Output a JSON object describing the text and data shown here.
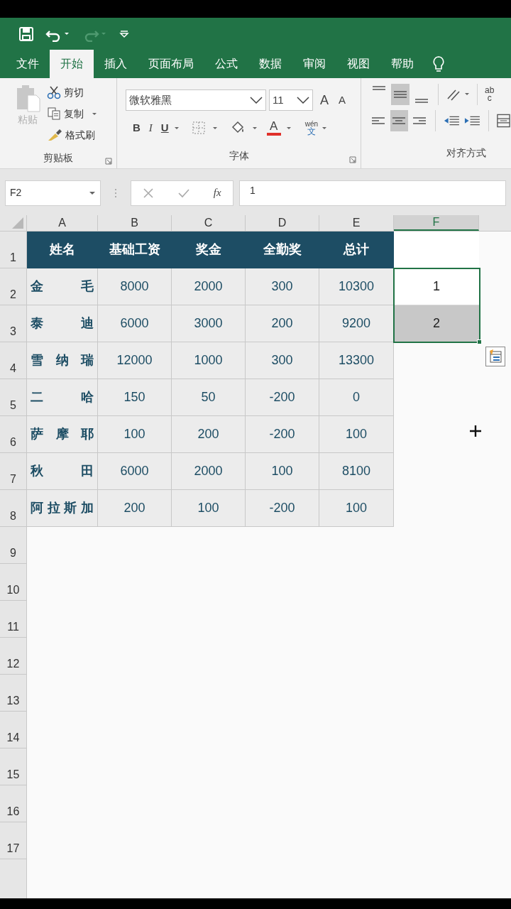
{
  "tabs": [
    {
      "label": "文件",
      "selected": false
    },
    {
      "label": "开始",
      "selected": true
    },
    {
      "label": "插入",
      "selected": false
    },
    {
      "label": "页面布局",
      "selected": false
    },
    {
      "label": "公式",
      "selected": false
    },
    {
      "label": "数据",
      "selected": false
    },
    {
      "label": "审阅",
      "selected": false
    },
    {
      "label": "视图",
      "selected": false
    },
    {
      "label": "帮助",
      "selected": false
    }
  ],
  "clipboard": {
    "paste": {
      "label": "粘贴",
      "disabled": true
    },
    "cut": "剪切",
    "copy": "复制",
    "format_painter": "格式刷",
    "group_label": "剪贴板"
  },
  "font": {
    "name": "微软雅黑",
    "size": "11",
    "grow": "A",
    "shrink": "A",
    "bold": "B",
    "italic": "I",
    "underline": "U",
    "font_color": "A",
    "phonetic_top": "wén",
    "phonetic_bottom": "文",
    "group_label": "字体"
  },
  "alignment": {
    "vertical": [
      {
        "kind": "top",
        "selected": false
      },
      {
        "kind": "middle",
        "selected": true
      },
      {
        "kind": "bottom",
        "selected": false
      }
    ],
    "horizontal": [
      {
        "kind": "left",
        "selected": false
      },
      {
        "kind": "center",
        "selected": true
      },
      {
        "kind": "right",
        "selected": false
      }
    ],
    "wrap_top": "ab",
    "wrap_bottom": "c",
    "group_label": "对齐方式"
  },
  "formula_bar": {
    "name_box": "F2",
    "fx": "fx",
    "value": "1"
  },
  "columns": [
    {
      "label": "A",
      "selected": false
    },
    {
      "label": "B",
      "selected": false
    },
    {
      "label": "C",
      "selected": false
    },
    {
      "label": "D",
      "selected": false
    },
    {
      "label": "E",
      "selected": false
    },
    {
      "label": "F",
      "selected": true
    }
  ],
  "row_numbers": [
    "1",
    "2",
    "3",
    "4",
    "5",
    "6",
    "7",
    "8",
    "9",
    "10",
    "11",
    "12",
    "13",
    "14",
    "15",
    "16",
    "17"
  ],
  "table": {
    "header": [
      "姓名",
      "基础工资",
      "奖金",
      "全勤奖",
      "总计"
    ],
    "rows": [
      [
        "金毛",
        "8000",
        "2000",
        "300",
        "10300"
      ],
      [
        "泰迪",
        "6000",
        "3000",
        "200",
        "9200"
      ],
      [
        "雪纳瑞",
        "12000",
        "1000",
        "300",
        "13300"
      ],
      [
        "二哈",
        "150",
        "50",
        "-200",
        "0"
      ],
      [
        "萨摩耶",
        "100",
        "200",
        "-200",
        "100"
      ],
      [
        "秋田",
        "6000",
        "2000",
        "100",
        "8100"
      ],
      [
        "阿拉斯加",
        "200",
        "100",
        "-200",
        "100"
      ]
    ]
  },
  "column_f": [
    {
      "value": "1",
      "highlighted": false
    },
    {
      "value": "2",
      "highlighted": true
    }
  ]
}
